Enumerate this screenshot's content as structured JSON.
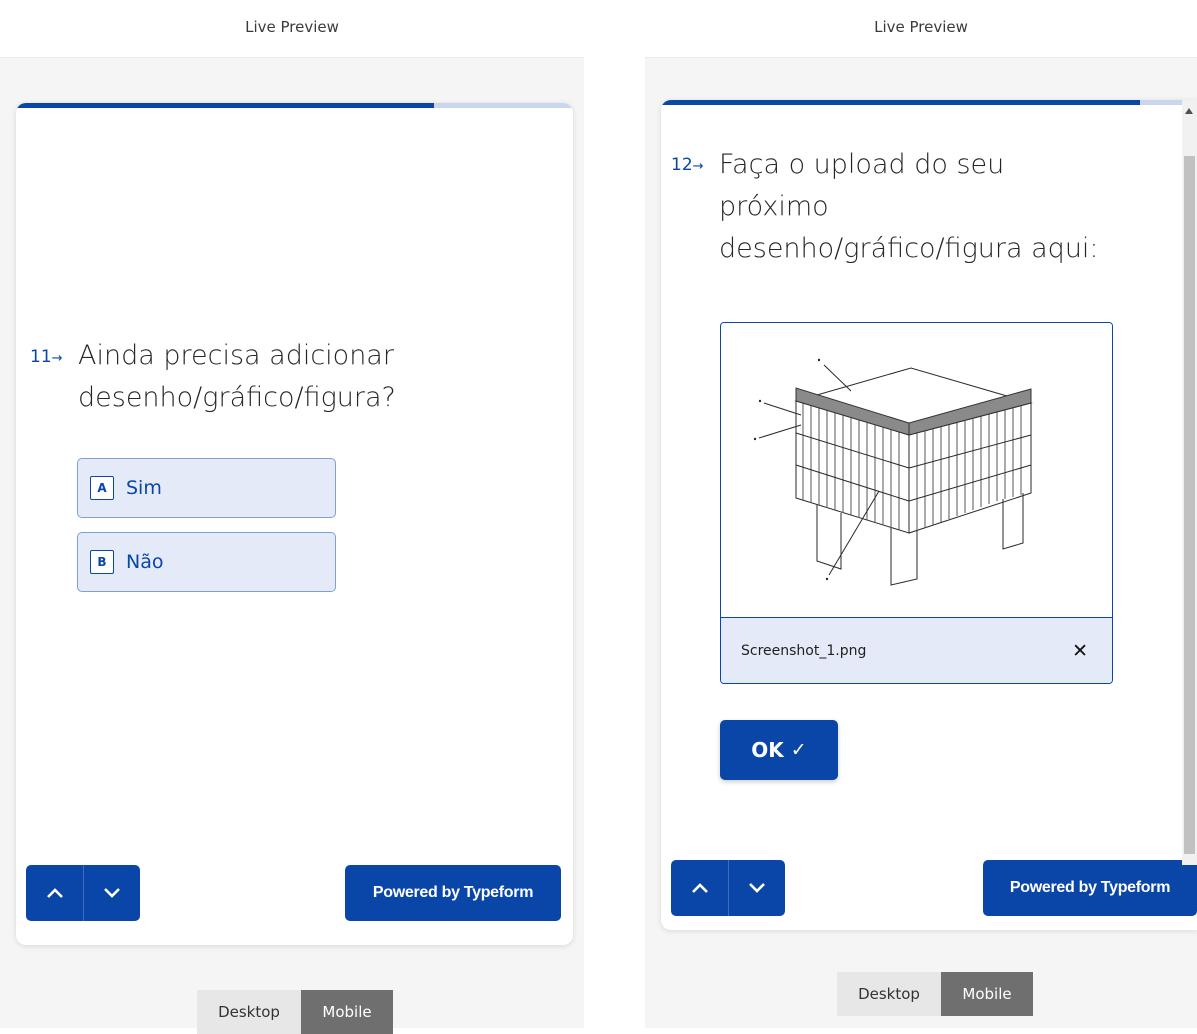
{
  "colors": {
    "accent": "#0a46a8",
    "choice_bg": "#e4eaf7",
    "toggle_active": "#6f6f6f",
    "stage_bg": "#f5f5f5"
  },
  "left_preview": {
    "header": "Live Preview",
    "progress": 0.75,
    "question": {
      "number": "11",
      "arrow": "→",
      "line1": "Ainda precisa adicionar",
      "line2": "desenho/gráfico/figura?"
    },
    "choices": [
      {
        "key": "A",
        "label": "Sim"
      },
      {
        "key": "B",
        "label": "Não"
      }
    ],
    "nav": {
      "up_icon": "chevron-up-icon",
      "down_icon": "chevron-down-icon"
    },
    "powered_by": "Powered by Typeform",
    "view_toggle": {
      "desktop": "Desktop",
      "mobile": "Mobile",
      "selected": "Mobile"
    }
  },
  "right_preview": {
    "header": "Live Preview",
    "progress": 0.92,
    "question": {
      "number": "12",
      "arrow": "→",
      "line1": "Faça o upload do seu",
      "line2": "próximo",
      "line3": "desenho/gráfico/figura aqui:"
    },
    "upload": {
      "file_name": "Screenshot_1.png",
      "remove_icon": "close-icon",
      "image": "technical-drawing-of-building-structure"
    },
    "ok_button": {
      "label": "OK",
      "icon": "check-icon"
    },
    "nav": {
      "up_icon": "chevron-up-icon",
      "down_icon": "chevron-down-icon"
    },
    "powered_by": "Powered by Typeform",
    "view_toggle": {
      "desktop": "Desktop",
      "mobile": "Mobile",
      "selected": "Mobile"
    }
  }
}
